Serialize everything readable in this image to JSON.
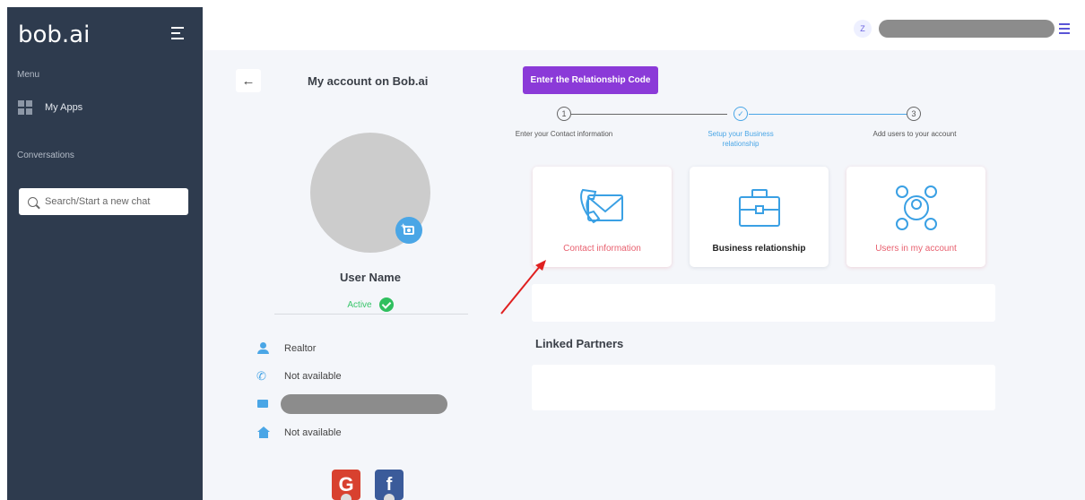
{
  "sidebar": {
    "logo": "bob.ai",
    "menu_label": "Menu",
    "apps_label": "My Apps",
    "conversations_label": "Conversations",
    "search_placeholder": "Search/Start a new chat"
  },
  "topbar": {
    "user_initial": "Z"
  },
  "account": {
    "title": "My account on Bob.ai",
    "user_name": "User Name",
    "status": "Active",
    "role": "Realtor",
    "phone": "Not available",
    "address": "Not available",
    "social": [
      {
        "letter": "G",
        "name": "google"
      },
      {
        "letter": "f",
        "name": "facebook"
      }
    ]
  },
  "relationship": {
    "button_label": "Enter the Relationship Code",
    "steps": [
      {
        "number": "1",
        "label": "Enter your Contact information"
      },
      {
        "number": "✓",
        "label": "Setup your Business relationship"
      },
      {
        "number": "3",
        "label": "Add users to your account"
      }
    ],
    "cards": [
      {
        "label": "Contact information",
        "icon": "contact-envelope-icon"
      },
      {
        "label": "Business relationship",
        "icon": "briefcase-icon"
      },
      {
        "label": "Users in my account",
        "icon": "users-network-icon"
      }
    ],
    "partners_title": "Linked Partners"
  },
  "colors": {
    "sidebar": "#2e3b4e",
    "accent_purple": "#8b3ad8",
    "accent_blue": "#4aa6e6",
    "pink_text": "#e8606f",
    "active_green": "#2fbf5e"
  }
}
